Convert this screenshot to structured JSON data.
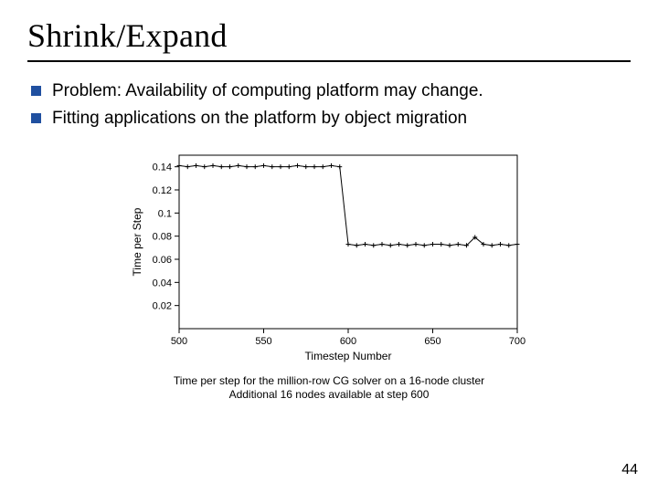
{
  "title": "Shrink/Expand",
  "bullets": [
    "Problem: Availability of computing platform may change.",
    "Fitting applications on the platform by object migration"
  ],
  "caption_line1": "Time per step for the million-row CG solver on a 16-node cluster",
  "caption_line2": "Additional 16 nodes available at step 600",
  "page_number": "44",
  "chart_data": {
    "type": "line",
    "title": "",
    "xlabel": "Timestep Number",
    "ylabel": "Time per Step",
    "xlim": [
      500,
      700
    ],
    "ylim": [
      0,
      0.15
    ],
    "xticks": [
      500,
      550,
      600,
      650,
      700
    ],
    "yticks": [
      0.02,
      0.04,
      0.06,
      0.08,
      0.1,
      0.12,
      0.14
    ],
    "series": [
      {
        "name": "time-per-step",
        "x": [
          500,
          505,
          510,
          515,
          520,
          525,
          530,
          535,
          540,
          545,
          550,
          555,
          560,
          565,
          570,
          575,
          580,
          585,
          590,
          595,
          600,
          605,
          610,
          615,
          620,
          625,
          630,
          635,
          640,
          645,
          650,
          655,
          660,
          665,
          670,
          675,
          680,
          685,
          690,
          695,
          700
        ],
        "y": [
          0.141,
          0.14,
          0.141,
          0.14,
          0.141,
          0.14,
          0.14,
          0.141,
          0.14,
          0.14,
          0.141,
          0.14,
          0.14,
          0.14,
          0.141,
          0.14,
          0.14,
          0.14,
          0.141,
          0.14,
          0.073,
          0.072,
          0.073,
          0.072,
          0.073,
          0.072,
          0.073,
          0.072,
          0.073,
          0.072,
          0.073,
          0.073,
          0.072,
          0.073,
          0.072,
          0.079,
          0.073,
          0.072,
          0.073,
          0.072,
          0.073
        ]
      }
    ]
  }
}
